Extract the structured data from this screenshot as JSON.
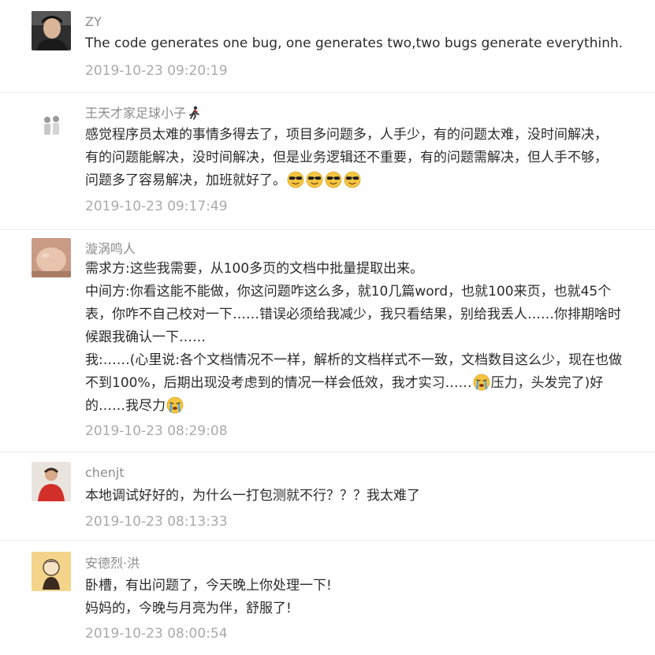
{
  "comments": [
    {
      "author": "ZY",
      "lines": [
        "The code generates one bug, one generates two,two bugs generate everythinh."
      ],
      "time": "2019-10-23 09:20:19"
    },
    {
      "author": "王天才家足球小子",
      "lines": [
        "感觉程序员太难的事情多得去了，项目多问题多，人手少，有的问题太难，没时间解决，",
        "有的问题能解决，没时间解决，但是业务逻辑还不重要，有的问题需解决，但人手不够，",
        "问题多了容易解决，加班就好了。"
      ],
      "emoji_trail": "sunglasses-emoji",
      "time": "2019-10-23 09:17:49"
    },
    {
      "author": "漩涡鸣人",
      "lines": [
        "需求方:这些我需要，从100多页的文档中批量提取出来。",
        "中间方:你看这能不能做，你这问题咋这么多，就10几篇word，也就100来页，也就45个",
        "表，你咋不自己校对一下……错误必须给我减少，我只看结果，别给我丢人……你排期啥时",
        "候跟我确认一下……",
        "我:……(心里说:各个文档情况不一样，解析的文档样式不一致，文档数目这么少，现在也做",
        "不到100%，后期出现没考虑到的情况一样会低效，我才实习……",
        "压力，头发完了)好",
        "的……我尽力"
      ],
      "emoji_crying": "crying-emoji",
      "time": "2019-10-23 08:29:08"
    },
    {
      "author": "chenjt",
      "lines": [
        "本地调试好好的，为什么一打包测就不行？？？我太难了"
      ],
      "time": "2019-10-23 08:13:33"
    },
    {
      "author": "安德烈·洪",
      "lines": [
        "卧槽，有出问题了，今天晚上你处理一下!",
        "妈妈的，今晚与月亮为伴，舒服了!"
      ],
      "time": "2019-10-23 08:00:54"
    }
  ]
}
